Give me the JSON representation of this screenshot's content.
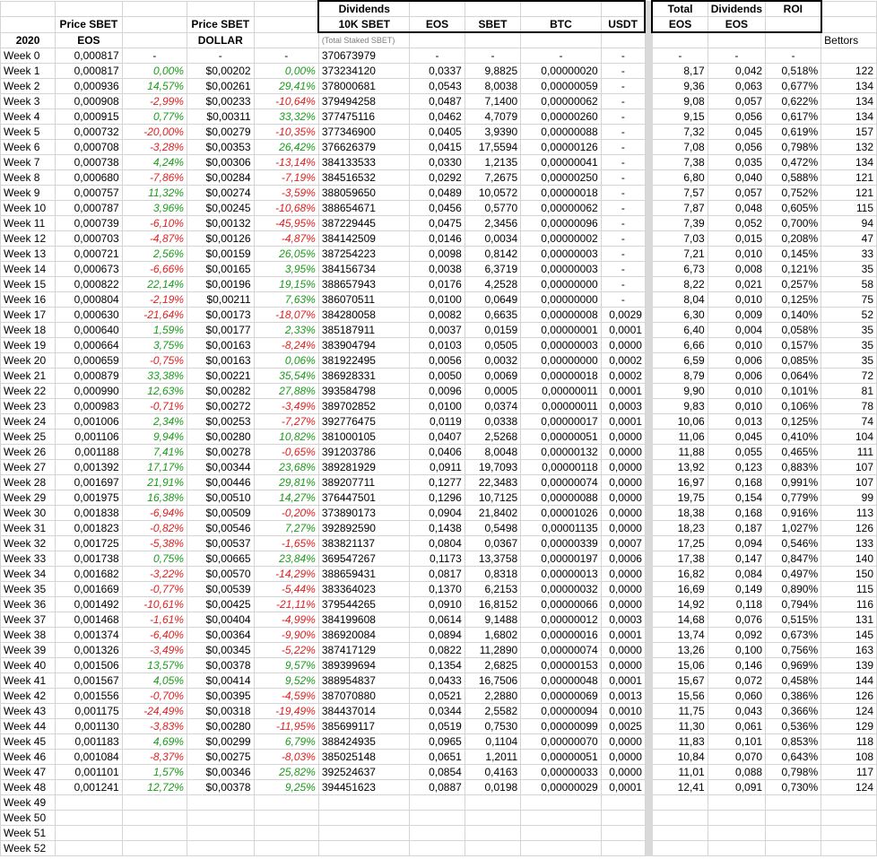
{
  "headers": {
    "year": "2020",
    "price_sbet": "Price SBET",
    "price_eos_unit": "EOS",
    "price_sbet_2": "Price SBET",
    "price_dollar_unit": "DOLLAR",
    "dividends": "Dividends",
    "ten_k_sbet": "10K SBET",
    "staked_note": "(Total Staked SBET)",
    "eos": "EOS",
    "sbet": "SBET",
    "btc": "BTC",
    "usdt": "USDT",
    "total": "Total",
    "total_eos": "EOS",
    "dividends_2": "Dividends",
    "dividends_eos": "EOS",
    "roi": "ROI",
    "bettors": "Bettors"
  },
  "week0": [
    "Week 0",
    "0,000817",
    "-",
    "-",
    "-",
    "370673979",
    "-",
    "-",
    "-",
    "-",
    "-",
    "-",
    "-",
    ""
  ],
  "rows": [
    [
      "Week 1",
      "0,000817",
      "0,00%",
      "$0,00202",
      "0,00%",
      "373234120",
      "0,0337",
      "9,8825",
      "0,00000020",
      "-",
      "8,17",
      "0,042",
      "0,518%",
      "122"
    ],
    [
      "Week 2",
      "0,000936",
      "14,57%",
      "$0,00261",
      "29,41%",
      "378000681",
      "0,0543",
      "8,0038",
      "0,00000059",
      "-",
      "9,36",
      "0,063",
      "0,677%",
      "134"
    ],
    [
      "Week 3",
      "0,000908",
      "-2,99%",
      "$0,00233",
      "-10,64%",
      "379494258",
      "0,0487",
      "7,1400",
      "0,00000062",
      "-",
      "9,08",
      "0,057",
      "0,622%",
      "134"
    ],
    [
      "Week 4",
      "0,000915",
      "0,77%",
      "$0,00311",
      "33,32%",
      "377475116",
      "0,0462",
      "4,7079",
      "0,00000260",
      "-",
      "9,15",
      "0,056",
      "0,617%",
      "134"
    ],
    [
      "Week 5",
      "0,000732",
      "-20,00%",
      "$0,00279",
      "-10,35%",
      "377346900",
      "0,0405",
      "3,9390",
      "0,00000088",
      "-",
      "7,32",
      "0,045",
      "0,619%",
      "157"
    ],
    [
      "Week 6",
      "0,000708",
      "-3,28%",
      "$0,00353",
      "26,42%",
      "376626379",
      "0,0415",
      "17,5594",
      "0,00000126",
      "-",
      "7,08",
      "0,056",
      "0,798%",
      "132"
    ],
    [
      "Week 7",
      "0,000738",
      "4,24%",
      "$0,00306",
      "-13,14%",
      "384133533",
      "0,0330",
      "1,2135",
      "0,00000041",
      "-",
      "7,38",
      "0,035",
      "0,472%",
      "134"
    ],
    [
      "Week 8",
      "0,000680",
      "-7,86%",
      "$0,00284",
      "-7,19%",
      "384516532",
      "0,0292",
      "7,2675",
      "0,00000250",
      "-",
      "6,80",
      "0,040",
      "0,588%",
      "121"
    ],
    [
      "Week 9",
      "0,000757",
      "11,32%",
      "$0,00274",
      "-3,59%",
      "388059650",
      "0,0489",
      "10,0572",
      "0,00000018",
      "-",
      "7,57",
      "0,057",
      "0,752%",
      "121"
    ],
    [
      "Week 10",
      "0,000787",
      "3,96%",
      "$0,00245",
      "-10,68%",
      "388654671",
      "0,0456",
      "0,5770",
      "0,00000062",
      "-",
      "7,87",
      "0,048",
      "0,605%",
      "115"
    ],
    [
      "Week 11",
      "0,000739",
      "-6,10%",
      "$0,00132",
      "-45,95%",
      "387229445",
      "0,0475",
      "2,3456",
      "0,00000096",
      "-",
      "7,39",
      "0,052",
      "0,700%",
      "94"
    ],
    [
      "Week 12",
      "0,000703",
      "-4,87%",
      "$0,00126",
      "-4,87%",
      "384142509",
      "0,0146",
      "0,0034",
      "0,00000002",
      "-",
      "7,03",
      "0,015",
      "0,208%",
      "47"
    ],
    [
      "Week 13",
      "0,000721",
      "2,56%",
      "$0,00159",
      "26,05%",
      "387254223",
      "0,0098",
      "0,8142",
      "0,00000003",
      "-",
      "7,21",
      "0,010",
      "0,145%",
      "33"
    ],
    [
      "Week 14",
      "0,000673",
      "-6,66%",
      "$0,00165",
      "3,95%",
      "384156734",
      "0,0038",
      "6,3719",
      "0,00000003",
      "-",
      "6,73",
      "0,008",
      "0,121%",
      "35"
    ],
    [
      "Week 15",
      "0,000822",
      "22,14%",
      "$0,00196",
      "19,15%",
      "388657943",
      "0,0176",
      "4,2528",
      "0,00000000",
      "-",
      "8,22",
      "0,021",
      "0,257%",
      "58"
    ],
    [
      "Week 16",
      "0,000804",
      "-2,19%",
      "$0,00211",
      "7,63%",
      "386070511",
      "0,0100",
      "0,0649",
      "0,00000000",
      "-",
      "8,04",
      "0,010",
      "0,125%",
      "75"
    ],
    [
      "Week 17",
      "0,000630",
      "-21,64%",
      "$0,00173",
      "-18,07%",
      "384280058",
      "0,0082",
      "0,6635",
      "0,00000008",
      "0,0029",
      "6,30",
      "0,009",
      "0,140%",
      "52"
    ],
    [
      "Week 18",
      "0,000640",
      "1,59%",
      "$0,00177",
      "2,33%",
      "385187911",
      "0,0037",
      "0,0159",
      "0,00000001",
      "0,0001",
      "6,40",
      "0,004",
      "0,058%",
      "35"
    ],
    [
      "Week 19",
      "0,000664",
      "3,75%",
      "$0,00163",
      "-8,24%",
      "383904794",
      "0,0103",
      "0,0505",
      "0,00000003",
      "0,0000",
      "6,66",
      "0,010",
      "0,157%",
      "35"
    ],
    [
      "Week 20",
      "0,000659",
      "-0,75%",
      "$0,00163",
      "0,06%",
      "381922495",
      "0,0056",
      "0,0032",
      "0,00000000",
      "0,0002",
      "6,59",
      "0,006",
      "0,085%",
      "35"
    ],
    [
      "Week 21",
      "0,000879",
      "33,38%",
      "$0,00221",
      "35,54%",
      "386928331",
      "0,0050",
      "0,0069",
      "0,00000018",
      "0,0002",
      "8,79",
      "0,006",
      "0,064%",
      "72"
    ],
    [
      "Week 22",
      "0,000990",
      "12,63%",
      "$0,00282",
      "27,88%",
      "393584798",
      "0,0096",
      "0,0005",
      "0,00000011",
      "0,0001",
      "9,90",
      "0,010",
      "0,101%",
      "81"
    ],
    [
      "Week 23",
      "0,000983",
      "-0,71%",
      "$0,00272",
      "-3,49%",
      "389702852",
      "0,0100",
      "0,0374",
      "0,00000011",
      "0,0003",
      "9,83",
      "0,010",
      "0,106%",
      "78"
    ],
    [
      "Week 24",
      "0,001006",
      "2,34%",
      "$0,00253",
      "-7,27%",
      "392776475",
      "0,0119",
      "0,0338",
      "0,00000017",
      "0,0001",
      "10,06",
      "0,013",
      "0,125%",
      "74"
    ],
    [
      "Week 25",
      "0,001106",
      "9,94%",
      "$0,00280",
      "10,82%",
      "381000105",
      "0,0407",
      "2,5268",
      "0,00000051",
      "0,0000",
      "11,06",
      "0,045",
      "0,410%",
      "104"
    ],
    [
      "Week 26",
      "0,001188",
      "7,41%",
      "$0,00278",
      "-0,65%",
      "391203786",
      "0,0406",
      "8,0048",
      "0,00000132",
      "0,0000",
      "11,88",
      "0,055",
      "0,465%",
      "111"
    ],
    [
      "Week 27",
      "0,001392",
      "17,17%",
      "$0,00344",
      "23,68%",
      "389281929",
      "0,0911",
      "19,7093",
      "0,00000118",
      "0,0000",
      "13,92",
      "0,123",
      "0,883%",
      "107"
    ],
    [
      "Week 28",
      "0,001697",
      "21,91%",
      "$0,00446",
      "29,81%",
      "389207711",
      "0,1277",
      "22,3483",
      "0,00000074",
      "0,0000",
      "16,97",
      "0,168",
      "0,991%",
      "107"
    ],
    [
      "Week 29",
      "0,001975",
      "16,38%",
      "$0,00510",
      "14,27%",
      "376447501",
      "0,1296",
      "10,7125",
      "0,00000088",
      "0,0000",
      "19,75",
      "0,154",
      "0,779%",
      "99"
    ],
    [
      "Week 30",
      "0,001838",
      "-6,94%",
      "$0,00509",
      "-0,20%",
      "373890173",
      "0,0904",
      "21,8402",
      "0,00001026",
      "0,0000",
      "18,38",
      "0,168",
      "0,916%",
      "113"
    ],
    [
      "Week 31",
      "0,001823",
      "-0,82%",
      "$0,00546",
      "7,27%",
      "392892590",
      "0,1438",
      "0,5498",
      "0,00001135",
      "0,0000",
      "18,23",
      "0,187",
      "1,027%",
      "126"
    ],
    [
      "Week 32",
      "0,001725",
      "-5,38%",
      "$0,00537",
      "-1,65%",
      "383821137",
      "0,0804",
      "0,0367",
      "0,00000339",
      "0,0007",
      "17,25",
      "0,094",
      "0,546%",
      "133"
    ],
    [
      "Week 33",
      "0,001738",
      "0,75%",
      "$0,00665",
      "23,84%",
      "369547267",
      "0,1173",
      "13,3758",
      "0,00000197",
      "0,0006",
      "17,38",
      "0,147",
      "0,847%",
      "140"
    ],
    [
      "Week 34",
      "0,001682",
      "-3,22%",
      "$0,00570",
      "-14,29%",
      "388659431",
      "0,0817",
      "0,8318",
      "0,00000013",
      "0,0000",
      "16,82",
      "0,084",
      "0,497%",
      "150"
    ],
    [
      "Week 35",
      "0,001669",
      "-0,77%",
      "$0,00539",
      "-5,44%",
      "383364023",
      "0,1370",
      "6,2153",
      "0,00000032",
      "0,0000",
      "16,69",
      "0,149",
      "0,890%",
      "115"
    ],
    [
      "Week 36",
      "0,001492",
      "-10,61%",
      "$0,00425",
      "-21,11%",
      "379544265",
      "0,0910",
      "16,8152",
      "0,00000066",
      "0,0000",
      "14,92",
      "0,118",
      "0,794%",
      "116"
    ],
    [
      "Week 37",
      "0,001468",
      "-1,61%",
      "$0,00404",
      "-4,99%",
      "384199608",
      "0,0614",
      "9,1488",
      "0,00000012",
      "0,0003",
      "14,68",
      "0,076",
      "0,515%",
      "131"
    ],
    [
      "Week 38",
      "0,001374",
      "-6,40%",
      "$0,00364",
      "-9,90%",
      "386920084",
      "0,0894",
      "1,6802",
      "0,00000016",
      "0,0001",
      "13,74",
      "0,092",
      "0,673%",
      "145"
    ],
    [
      "Week 39",
      "0,001326",
      "-3,49%",
      "$0,00345",
      "-5,22%",
      "387417129",
      "0,0822",
      "11,2890",
      "0,00000074",
      "0,0000",
      "13,26",
      "0,100",
      "0,756%",
      "163"
    ],
    [
      "Week 40",
      "0,001506",
      "13,57%",
      "$0,00378",
      "9,57%",
      "389399694",
      "0,1354",
      "2,6825",
      "0,00000153",
      "0,0000",
      "15,06",
      "0,146",
      "0,969%",
      "139"
    ],
    [
      "Week 41",
      "0,001567",
      "4,05%",
      "$0,00414",
      "9,52%",
      "388954837",
      "0,0433",
      "16,7506",
      "0,00000048",
      "0,0001",
      "15,67",
      "0,072",
      "0,458%",
      "144"
    ],
    [
      "Week 42",
      "0,001556",
      "-0,70%",
      "$0,00395",
      "-4,59%",
      "387070880",
      "0,0521",
      "2,2880",
      "0,00000069",
      "0,0013",
      "15,56",
      "0,060",
      "0,386%",
      "126"
    ],
    [
      "Week 43",
      "0,001175",
      "-24,49%",
      "$0,00318",
      "-19,49%",
      "384437014",
      "0,0344",
      "2,5582",
      "0,00000094",
      "0,0010",
      "11,75",
      "0,043",
      "0,366%",
      "124"
    ],
    [
      "Week 44",
      "0,001130",
      "-3,83%",
      "$0,00280",
      "-11,95%",
      "385699117",
      "0,0519",
      "0,7530",
      "0,00000099",
      "0,0025",
      "11,30",
      "0,061",
      "0,536%",
      "129"
    ],
    [
      "Week 45",
      "0,001183",
      "4,69%",
      "$0,00299",
      "6,79%",
      "388424935",
      "0,0965",
      "0,1104",
      "0,00000070",
      "0,0000",
      "11,83",
      "0,101",
      "0,853%",
      "118"
    ],
    [
      "Week 46",
      "0,001084",
      "-8,37%",
      "$0,00275",
      "-8,03%",
      "385025148",
      "0,0651",
      "1,2011",
      "0,00000051",
      "0,0000",
      "10,84",
      "0,070",
      "0,643%",
      "108"
    ],
    [
      "Week 47",
      "0,001101",
      "1,57%",
      "$0,00346",
      "25,82%",
      "392524637",
      "0,0854",
      "0,4163",
      "0,00000033",
      "0,0000",
      "11,01",
      "0,088",
      "0,798%",
      "117"
    ],
    [
      "Week 48",
      "0,001241",
      "12,72%",
      "$0,00378",
      "9,25%",
      "394451623",
      "0,0887",
      "0,0198",
      "0,00000029",
      "0,0001",
      "12,41",
      "0,091",
      "0,730%",
      "124"
    ]
  ],
  "empty_weeks": [
    "Week 49",
    "Week 50",
    "Week 51",
    "Week 52"
  ],
  "colors": {
    "positive": "#1a9c1a",
    "negative": "#e02020",
    "grid": "#d4d4d4",
    "separator": "#d9d9d9"
  }
}
